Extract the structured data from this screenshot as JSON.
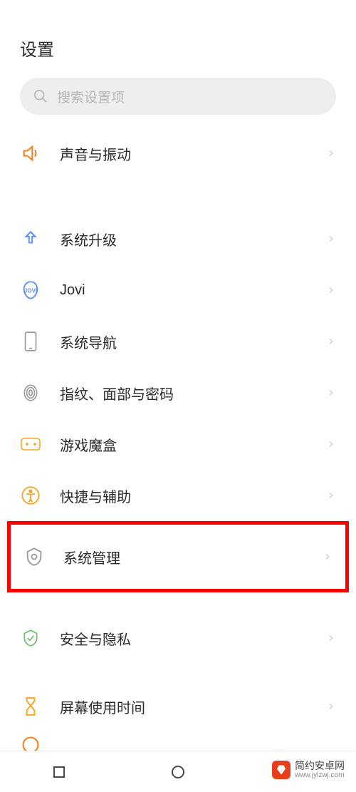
{
  "header": {
    "title": "设置"
  },
  "search": {
    "placeholder": "搜索设置项"
  },
  "items": {
    "sound": {
      "label": "声音与振动"
    },
    "upgrade": {
      "label": "系统升级"
    },
    "jovi": {
      "label": "Jovi"
    },
    "navigation": {
      "label": "系统导航"
    },
    "biometric": {
      "label": "指纹、面部与密码"
    },
    "gamebox": {
      "label": "游戏魔盒"
    },
    "accessibility": {
      "label": "快捷与辅助"
    },
    "system_mgmt": {
      "label": "系统管理"
    },
    "security": {
      "label": "安全与隐私"
    },
    "screentime": {
      "label": "屏幕使用时间"
    }
  },
  "colors": {
    "highlight_border": "#ff0000",
    "icon_orange": "#f58220",
    "icon_blue": "#5b8ff9",
    "icon_gray": "#9a9a9a",
    "icon_green": "#6ac26a"
  },
  "watermark": {
    "name": "简约安卓网",
    "url": "www.jylzwj.com"
  }
}
